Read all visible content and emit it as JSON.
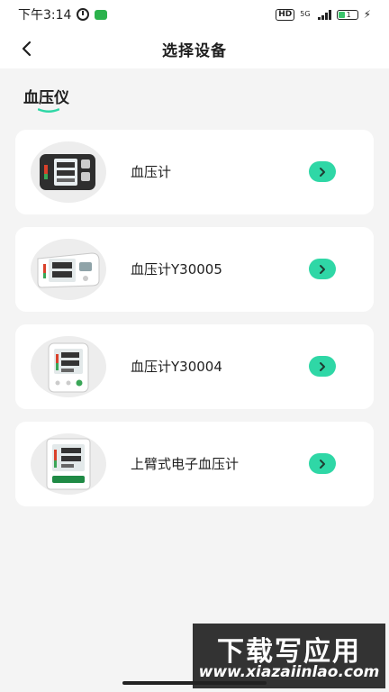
{
  "status_bar": {
    "time": "下午3:14",
    "hd": "HD",
    "network": "5G",
    "battery": "1"
  },
  "header": {
    "title": "选择设备"
  },
  "section": {
    "title": "血压仪",
    "accent_color": "#2fd7a6"
  },
  "devices": [
    {
      "name": "血压计",
      "icon": "blood-pressure-monitor-dark"
    },
    {
      "name": "血压计Y30005",
      "icon": "blood-pressure-monitor-wide"
    },
    {
      "name": "血压计Y30004",
      "icon": "blood-pressure-monitor-white"
    },
    {
      "name": "上臂式电子血压计",
      "icon": "blood-pressure-monitor-upper-arm"
    }
  ],
  "watermark": {
    "title": "下载写应用",
    "url": "www.xiazaiinlao.com"
  }
}
